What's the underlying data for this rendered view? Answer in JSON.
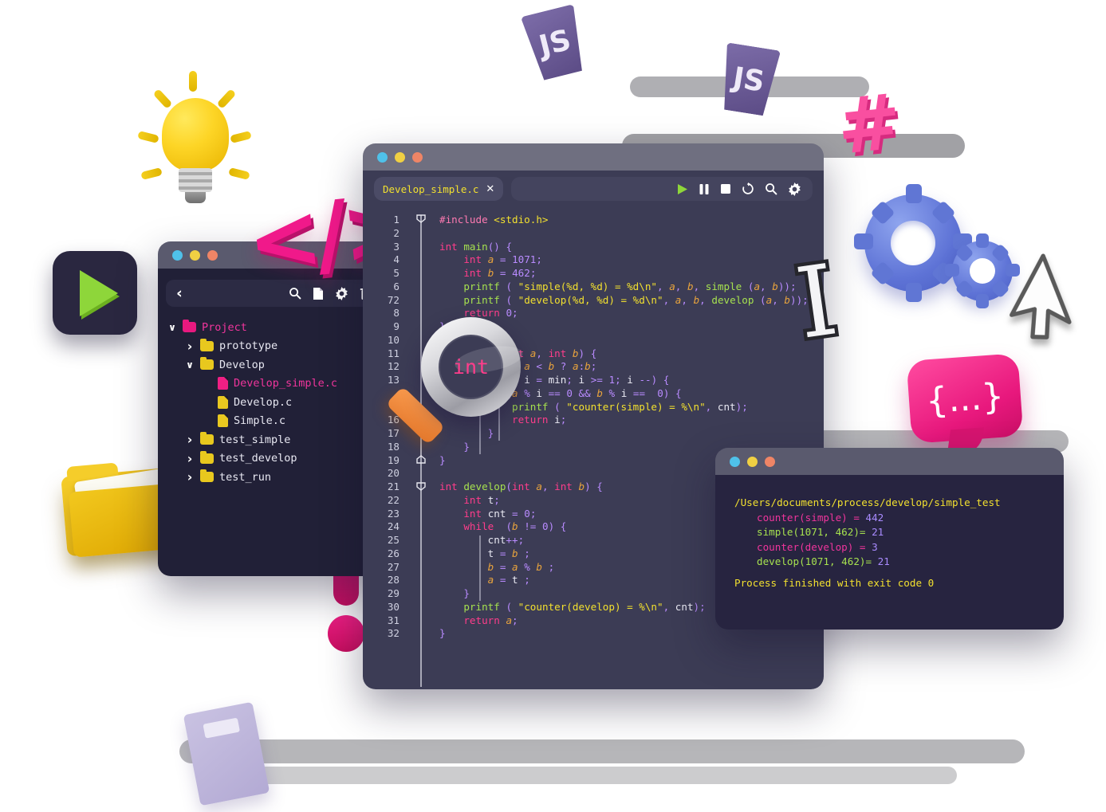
{
  "explorer": {
    "window_name": "file-explorer",
    "traffic_lights": [
      "blue",
      "yellow",
      "red"
    ],
    "toolbar": {
      "back_label": "‹",
      "icons": [
        "search-icon",
        "new-file-icon",
        "gear-icon",
        "trash-icon"
      ]
    },
    "tree": [
      {
        "label": "Project",
        "type": "folder",
        "color": "pink",
        "state": "open",
        "depth": 0
      },
      {
        "label": "prototype",
        "type": "folder",
        "color": "yellow",
        "state": "closed",
        "depth": 1
      },
      {
        "label": "Develop",
        "type": "folder",
        "color": "yellow",
        "state": "open",
        "depth": 1
      },
      {
        "label": "Develop_simple.c",
        "type": "file",
        "color": "pink",
        "state": "none",
        "depth": 2
      },
      {
        "label": "Develop.c",
        "type": "file",
        "color": "yellow",
        "state": "none",
        "depth": 2
      },
      {
        "label": "Simple.c",
        "type": "file",
        "color": "yellow",
        "state": "none",
        "depth": 2
      },
      {
        "label": "test_simple",
        "type": "folder",
        "color": "yellow",
        "state": "closed",
        "depth": 1
      },
      {
        "label": "test_develop",
        "type": "folder",
        "color": "yellow",
        "state": "closed",
        "depth": 1
      },
      {
        "label": "test_run",
        "type": "folder",
        "color": "yellow",
        "state": "closed",
        "depth": 1
      }
    ]
  },
  "editor": {
    "window_name": "code-editor",
    "traffic_lights": [
      "blue",
      "yellow",
      "red"
    ],
    "tab": {
      "label": "Develop_simple.c",
      "close_label": "✕"
    },
    "toolbar_icons": [
      "run-icon",
      "pause-icon",
      "stop-icon",
      "refresh-icon",
      "search-icon",
      "gear-icon"
    ],
    "line_numbers": [
      "1",
      "2",
      "3",
      "4",
      "5",
      "6",
      "72",
      "8",
      "9",
      "10",
      "11",
      "12",
      "13",
      "",
      "",
      "16",
      "17",
      "18",
      "19",
      "20",
      "21",
      "22",
      "23",
      "24",
      "25",
      "26",
      "27",
      "28",
      "29",
      "30",
      "31",
      "32"
    ],
    "code_lines": [
      "#include <stdio.h>",
      "",
      "int main() {",
      "    int a = 1071;",
      "    int b = 462;",
      "    printf ( \"simple(%d, %d) = %d\\n\", a, b, simple (a, b));",
      "    printf ( \"develop(%d, %d) = %d\\n\", a, b, develop (a, b));",
      "    return 0;",
      "}",
      "",
      "int simple(int a, int b) {",
      "    int min = a < b ? a:b;",
      "    for ( int i = min; i >= 1; i --) {",
      "        if (a % i == 0 && b % i ==  0) {",
      "            printf ( \"counter(simple) = %\\n\", cnt);",
      "            return i;",
      "        }",
      "    }",
      "}",
      "",
      "int develop(int a, int b) {",
      "    int t;",
      "    int cnt = 0;",
      "    while  (b != 0) {",
      "        cnt++;",
      "        t = b ;",
      "        b = a % b ;",
      "        a = t ;",
      "    }",
      "    printf ( \"counter(develop) = %\\n\", cnt);",
      "    return a;",
      "}"
    ],
    "magnifier": {
      "magnified_word": "int"
    }
  },
  "terminal": {
    "window_name": "output-console",
    "traffic_lights": [
      "blue",
      "yellow",
      "red"
    ],
    "path": "/Users/documents/process/develop/simple_test",
    "rows": [
      {
        "label": "counter(simple) =",
        "value": "442",
        "style": "pink"
      },
      {
        "label": "simple(1071, 462)=",
        "value": "21",
        "style": "green"
      },
      {
        "label": "counter(develop) =",
        "value": "3",
        "style": "pink"
      },
      {
        "label": "develop(1071, 462)=",
        "value": "21",
        "style": "green"
      }
    ],
    "finished_text": "Process finished with exit code 0"
  },
  "decorations": {
    "lightbulb": "lightbulb-icon",
    "code_brackets": "</>",
    "play_button": "play-icon",
    "folder": "open-folder-icon",
    "exclamation": "exclamation-mark-icon",
    "gears": "gears-icon",
    "text_cursor": "I",
    "mouse_pointer": "mouse-cursor-icon",
    "curly_bubble": "{...}",
    "hashtag": "#",
    "badge_left": "JS",
    "badge_right": "JS",
    "book": "book-icon"
  },
  "colors": {
    "editor_bg": "#3c3c55",
    "explorer_bg": "#212037",
    "terminal_bg": "#272440",
    "titlebar": "#6f6f80",
    "accent_pink": "#f01f84",
    "accent_yellow": "#f2e02f",
    "accent_green": "#a6e14f",
    "accent_purple": "#b98bff",
    "traffic_blue": "#4fc1e9",
    "traffic_yellow": "#f0d043",
    "traffic_red": "#ef8566"
  }
}
